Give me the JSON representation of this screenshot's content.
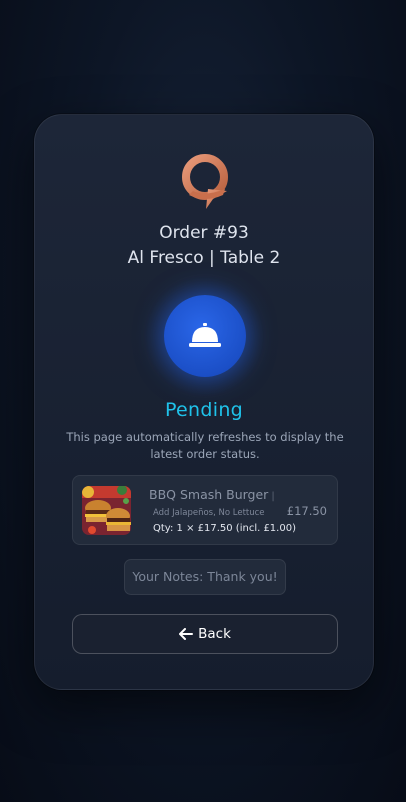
{
  "order": {
    "title": "Order #93",
    "location": "Al Fresco | Table 2"
  },
  "status": {
    "label": "Pending",
    "note": "This page automatically refreshes to display the latest order status.",
    "color": "#1fc2ea"
  },
  "items": [
    {
      "name": "BBQ Smash Burger",
      "separator": "|",
      "modifiers": "Add Jalapeños, No Lettuce",
      "qty_line": "Qty: 1 × £17.50 (incl. £1.00)",
      "price": "£17.50",
      "image": "burger-photo"
    }
  ],
  "notes": {
    "text": "Your Notes: Thank you!"
  },
  "back_button": {
    "label": "Back",
    "icon": "arrow-left-icon"
  },
  "icons": {
    "logo": "q-logo-icon",
    "status": "concierge-bell-icon"
  },
  "colors": {
    "accent_blue": "#1b4fc7",
    "logo_orange": "#d9836a"
  }
}
